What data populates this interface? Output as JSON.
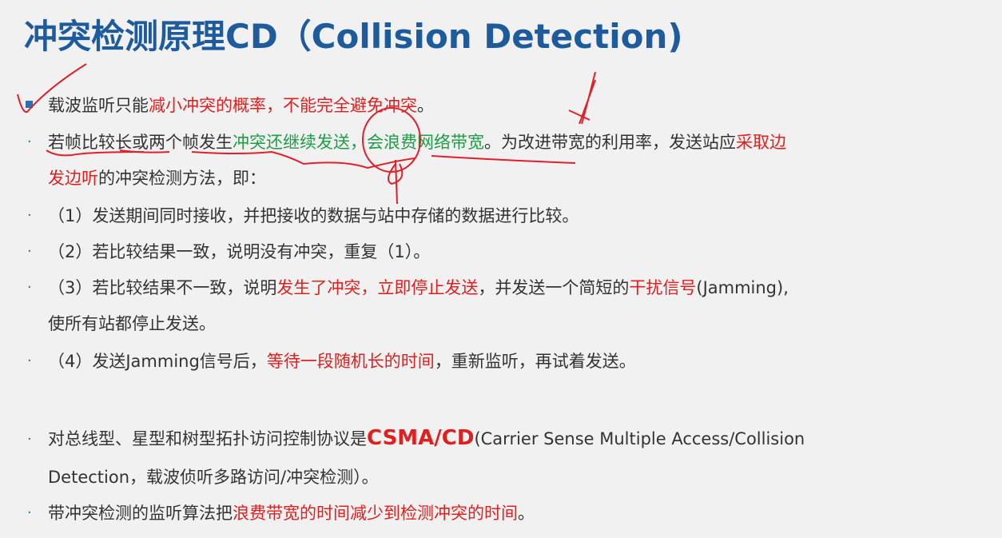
{
  "title": "冲突检测原理CD（Collision Detection)",
  "p1": {
    "a": "载波监听只能",
    "b": "减小冲突的概率，不能完全避免冲突",
    "c": "。"
  },
  "p2": {
    "a": "若帧比较长或两个帧发生",
    "b": "冲突还继续发送，会浪费网络带宽",
    "c": "。为改进带宽的利用率，发送站应",
    "d": "采取边",
    "e": "发边听",
    "f": "的冲突检测方法，即："
  },
  "p3": "（1）发送期间同时接收，并把接收的数据与站中存储的数据进行比较。",
  "p4": "（2）若比较结果一致，说明没有冲突，重复（1）。",
  "p5": {
    "a": "（3）若比较结果不一致，说明",
    "b": "发生了冲突，立即停止发送",
    "c": "，并发送一个简短的",
    "d": "干扰信号",
    "e": "(Jamming),",
    "f": "使所有站都停止发送。"
  },
  "p6": {
    "a": "（4）发送Jamming信号后，",
    "b": "等待一段随机长的时间",
    "c": "，重新监听，再试着发送。"
  },
  "p7": {
    "a": "对总线型、星型和树型拓扑访问控制协议是",
    "b": "CSMA/CD",
    "c": "(Carrier Sense Multiple Access/Collision",
    "d": "Detection，载波侦听多路访问/冲突检测）。"
  },
  "p8": {
    "a": "带冲突检测的监听算法把",
    "b": "浪费带宽的时间减少到检测冲突的时间",
    "c": "。"
  },
  "colors": {
    "title": "#1e5b9c",
    "red": "#e02020",
    "green": "#1f9c48",
    "bullet": "#2a6fb0",
    "ink": "#e0202a"
  }
}
